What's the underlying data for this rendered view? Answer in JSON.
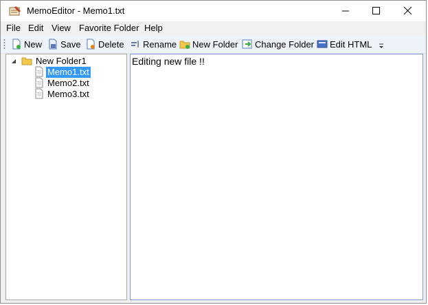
{
  "window": {
    "title": "MemoEditor - Memo1.txt"
  },
  "menu": {
    "items": [
      "File",
      "Edit",
      "View",
      "Favorite Folder",
      "Help"
    ]
  },
  "toolbar": {
    "new_label": "New",
    "save_label": "Save",
    "delete_label": "Delete",
    "rename_label": "Rename",
    "new_folder_label": "New Folder",
    "change_folder_label": "Change Folder",
    "edit_html_label": "Edit HTML"
  },
  "tree": {
    "folder": {
      "name": "New Folder1",
      "expanded": true,
      "icon": "folder-icon"
    },
    "files": [
      {
        "name": "Memo1.txt",
        "selected": true,
        "icon": "text-file-icon"
      },
      {
        "name": "Memo2.txt",
        "selected": false,
        "icon": "text-file-icon"
      },
      {
        "name": "Memo3.txt",
        "selected": false,
        "icon": "text-file-icon"
      }
    ]
  },
  "editor": {
    "content": "Editing new file !!"
  },
  "colors": {
    "selection": "#3399ff",
    "toolbar_bg": "#eef2f9",
    "editor_border": "#7a9cd3"
  }
}
